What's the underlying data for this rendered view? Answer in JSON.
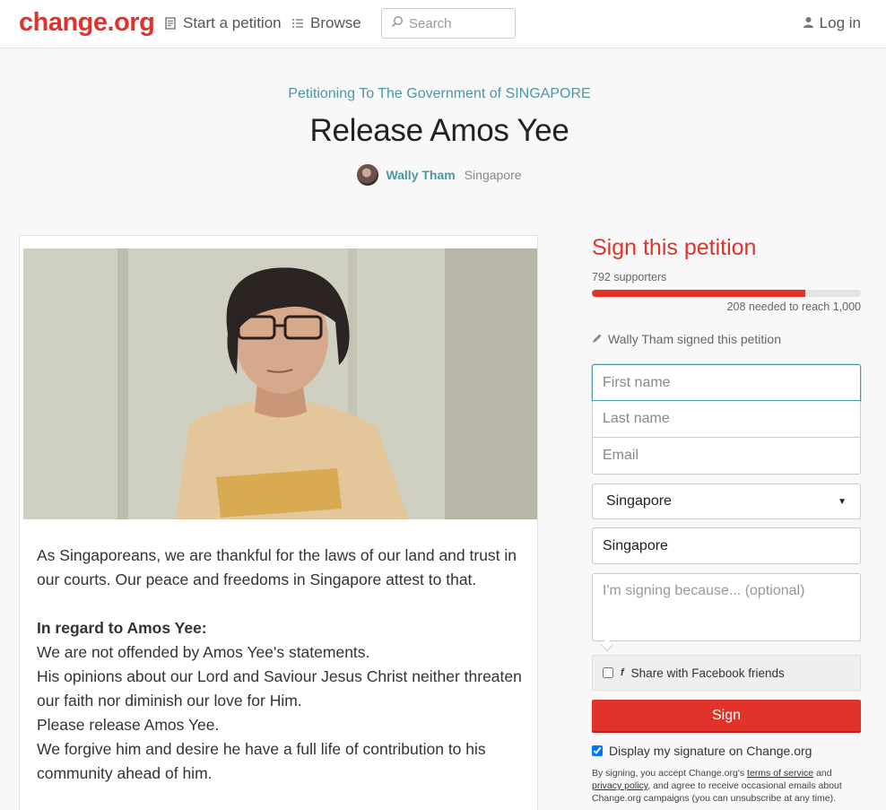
{
  "header": {
    "logo": "change.org",
    "nav": [
      {
        "label": "Start a petition",
        "icon": "document-icon"
      },
      {
        "label": "Browse",
        "icon": "list-icon"
      }
    ],
    "search_placeholder": "Search",
    "login_label": "Log in"
  },
  "petition": {
    "petitioning": "Petitioning To The Government of SINGAPORE",
    "title": "Release Amos Yee",
    "author_name": "Wally Tham",
    "author_location": "Singapore",
    "body": {
      "intro": "As Singaporeans, we are thankful for the laws of our land and trust in our courts. Our peace and freedoms in Singapore attest to that.",
      "heading": "In regard to Amos Yee:",
      "lines": [
        "We are not offended by Amos Yee's statements.",
        "His opinions about our Lord and Saviour Jesus Christ neither threaten our faith nor diminish our love for Him.",
        "Please release Amos Yee.",
        "We forgive him and desire he have a full life of contribution to his community ahead of him."
      ]
    }
  },
  "sign": {
    "title": "Sign this petition",
    "supporters": "792 supporters",
    "progress_fraction": 0.792,
    "needed": "208 needed to reach 1,000",
    "signed_note": "Wally Tham signed this petition",
    "first_name_placeholder": "First name",
    "last_name_placeholder": "Last name",
    "email_placeholder": "Email",
    "country": "Singapore",
    "city": "Singapore",
    "reason_placeholder": "I'm signing because... (optional)",
    "share_facebook": "Share with Facebook friends",
    "button": "Sign",
    "display_signature": "Display my signature on Change.org",
    "legal_prefix": "By signing, you accept Change.org's",
    "terms_link": "terms of service",
    "legal_and": "and",
    "privacy_link": "privacy policy",
    "legal_suffix": ", and agree to receive occasional emails about Change.org campaigns (you can unsubscribe at any time).",
    "accent_color": "#e1332a"
  }
}
